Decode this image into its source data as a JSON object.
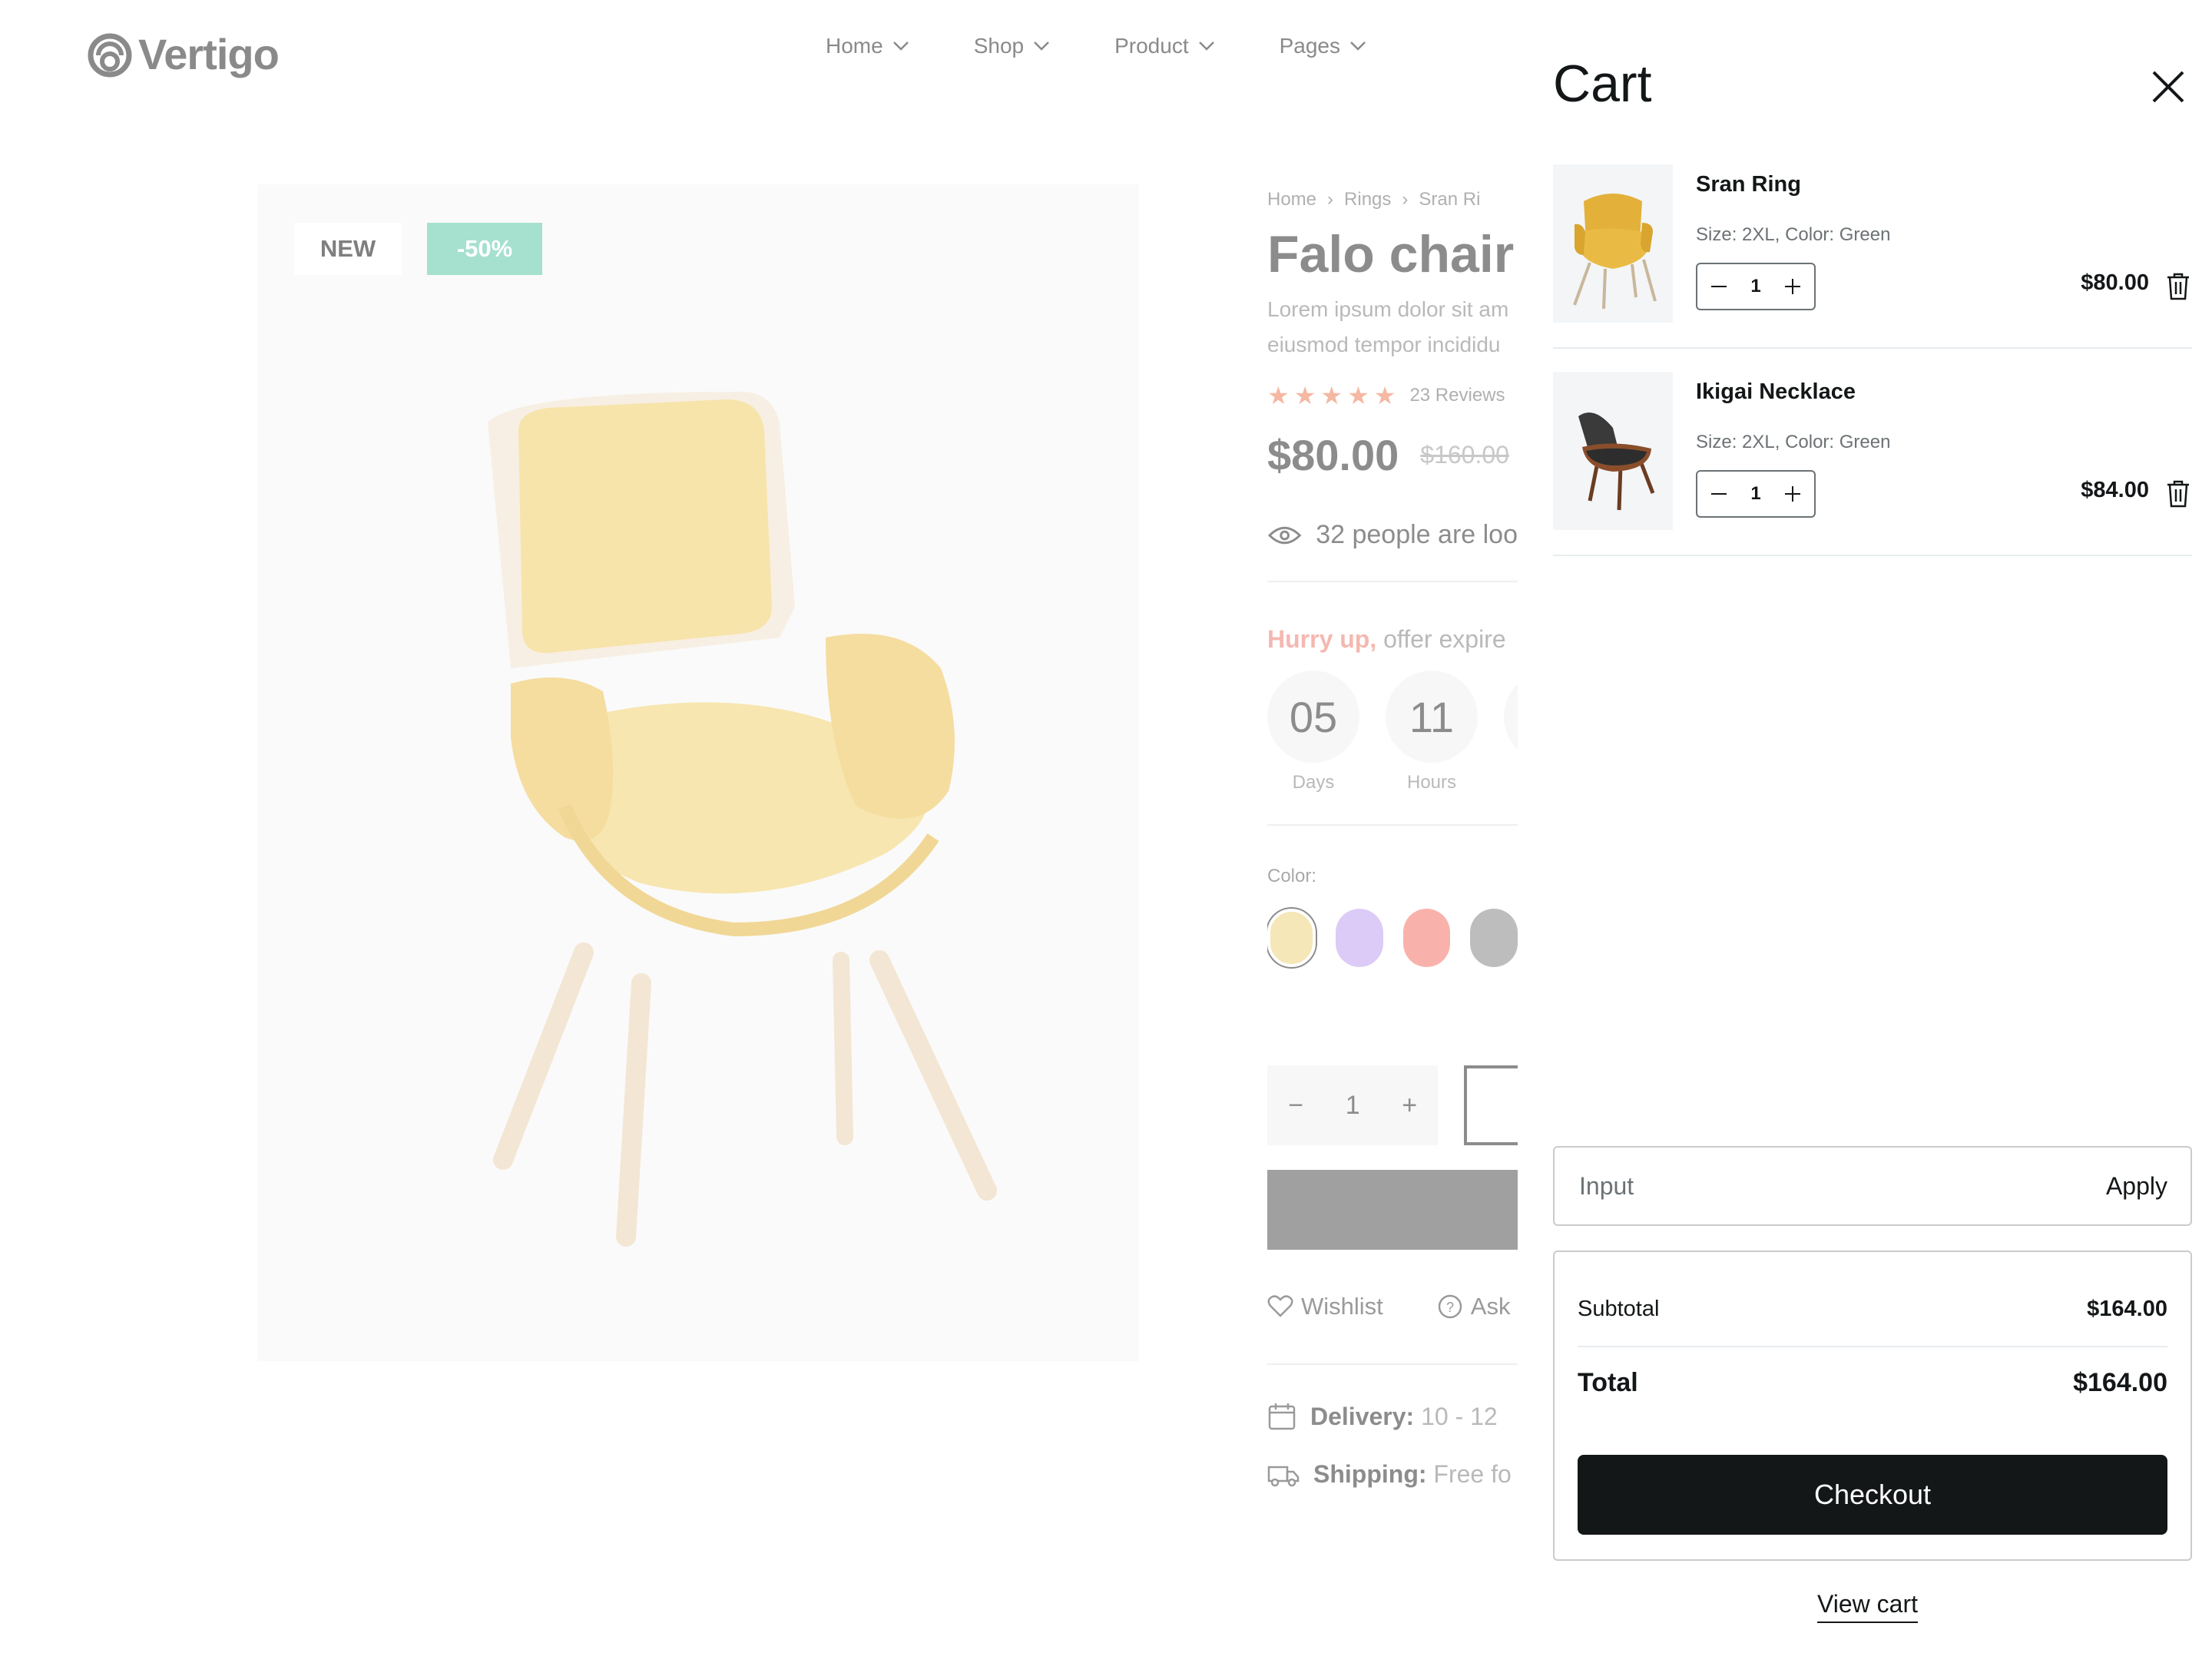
{
  "brand": {
    "name": "Vertigo"
  },
  "nav": {
    "items": [
      {
        "label": "Home"
      },
      {
        "label": "Shop"
      },
      {
        "label": "Product"
      },
      {
        "label": "Pages"
      }
    ]
  },
  "gallery": {
    "badge_new": "NEW",
    "badge_discount": "-50%"
  },
  "product": {
    "breadcrumb": [
      "Home",
      "Rings",
      "Sran Ri"
    ],
    "title": "Falo chair",
    "description_lines": [
      "Lorem ipsum dolor sit am",
      "eiusmod tempor incididu"
    ],
    "rating": 5,
    "reviews": "23 Reviews",
    "price": "$80.00",
    "old_price": "$160.00",
    "viewers": "32 people are loo",
    "hurry_highlight": "Hurry up,",
    "hurry_rest": " offer expire",
    "timer": [
      {
        "value": "05",
        "label": "Days"
      },
      {
        "value": "11",
        "label": "Hours"
      }
    ],
    "color_label": "Color:",
    "colors": [
      "#f5e7b8",
      "#dccbf7",
      "#f9b2ab",
      "#bdbdbd"
    ],
    "quantity": "1",
    "wishlist": "Wishlist",
    "ask": "Ask",
    "delivery_label": "Delivery:",
    "delivery_value": "10 - 12",
    "shipping_label": "Shipping:",
    "shipping_value": "Free fo"
  },
  "cart": {
    "title": "Cart",
    "items": [
      {
        "name": "Sran Ring",
        "meta": "Size: 2XL, Color: Green",
        "quantity": "1",
        "price": "$80.00",
        "icon": "yellow-chair"
      },
      {
        "name": "Ikigai Necklace",
        "meta": "Size: 2XL, Color: Green",
        "quantity": "1",
        "price": "$84.00",
        "icon": "dark-lounge-chair"
      }
    ],
    "coupon": {
      "placeholder": "Input",
      "apply_label": "Apply"
    },
    "subtotal_label": "Subtotal",
    "subtotal_value": "$164.00",
    "total_label": "Total",
    "total_value": "$164.00",
    "checkout_label": "Checkout",
    "view_cart_label": "View cart"
  }
}
